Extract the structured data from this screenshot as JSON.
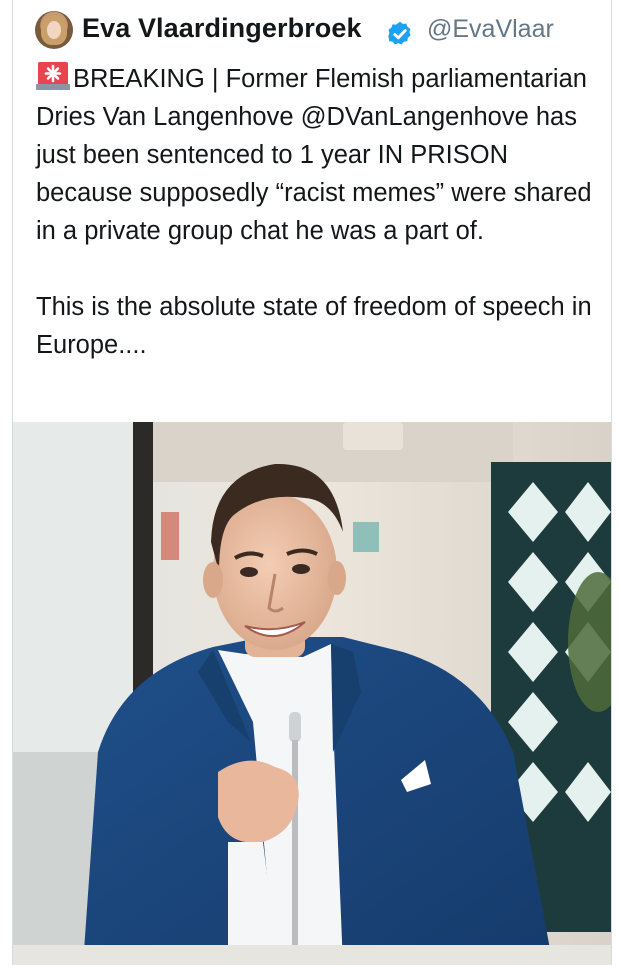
{
  "tweet": {
    "author": {
      "display_name": "Eva Vlaardingerbroek",
      "handle": "@EvaVlaar",
      "verified": true,
      "avatar": "profile-photo"
    },
    "text_paragraph_1": "BREAKING | Former Flemish parliamentarian Dries Van Langenhove @DVanLangenhove has just been sentenced to 1 year IN PRISON because supposedly “racist memes” were shared in a private group chat he was a part of.",
    "text_paragraph_2": "This is the absolute state of freedom of speech in Europe....",
    "leading_emoji": "siren-icon",
    "media": {
      "type": "photo",
      "subject": "man in blue suit speaking into a microphone"
    }
  },
  "colors": {
    "text": "#14171a",
    "secondary_text": "#657786",
    "verified_badge": "#1da1f2",
    "border": "#d6dbe0"
  }
}
